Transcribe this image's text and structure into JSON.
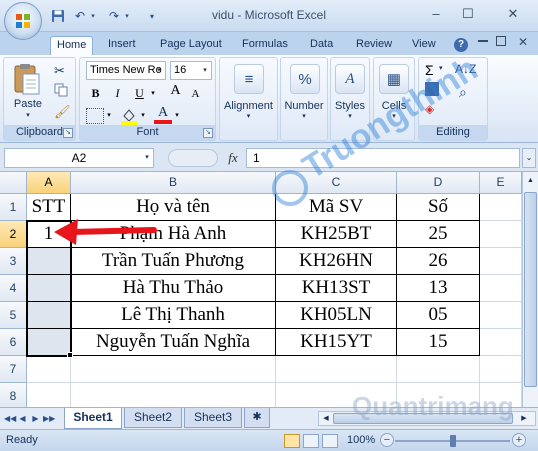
{
  "window": {
    "title": "vidu - Microsoft Excel",
    "minimize": "–",
    "maximize": "☐",
    "close": "✕"
  },
  "quick_access": {
    "save_icon": "save-icon",
    "undo_icon": "undo-icon",
    "redo_icon": "redo-icon"
  },
  "ribbon": {
    "tabs": [
      "Home",
      "Insert",
      "Page Layout",
      "Formulas",
      "Data",
      "Review",
      "View"
    ],
    "active_tab": "Home",
    "clipboard": {
      "label": "Clipboard",
      "paste": "Paste"
    },
    "font": {
      "label": "Font",
      "font_name": "Times New Ro",
      "font_size": "16",
      "bold": "B",
      "italic": "I",
      "underline": "U",
      "grow": "A",
      "shrink": "A"
    },
    "alignment": {
      "label": "Alignment"
    },
    "number": {
      "label": "Number",
      "icon_text": "%"
    },
    "styles": {
      "label": "Styles"
    },
    "cells": {
      "label": "Cells"
    },
    "editing": {
      "label": "Editing",
      "sum": "Σ"
    }
  },
  "formula_bar": {
    "name_box": "A2",
    "fx": "fx",
    "value": "1"
  },
  "grid": {
    "columns": [
      "A",
      "B",
      "C",
      "D",
      "E"
    ],
    "rows": [
      "1",
      "2",
      "3",
      "4",
      "5",
      "6",
      "7",
      "8"
    ],
    "selected_cell": "A2",
    "cells": [
      [
        "STT",
        "Họ và tên",
        "Mã SV",
        "Số"
      ],
      [
        "1",
        "Phạm Hà Anh",
        "KH25BT",
        "25"
      ],
      [
        "",
        "Trần Tuấn Phương",
        "KH26HN",
        "26"
      ],
      [
        "",
        "Hà Thu Thảo",
        "KH13ST",
        "13"
      ],
      [
        "",
        "Lê Thị Thanh",
        "KH05LN",
        "05"
      ],
      [
        "",
        "Nguyễn Tuấn Nghĩa",
        "KH15YT",
        "15"
      ]
    ]
  },
  "sheets": {
    "tabs": [
      "Sheet1",
      "Sheet2",
      "Sheet3"
    ],
    "active": "Sheet1"
  },
  "status": {
    "text": "Ready",
    "zoom": "100%",
    "zoom_minus": "−",
    "zoom_plus": "+"
  },
  "watermark": {
    "text_1": "Truongthinh",
    "text_2": "Quantrimang"
  },
  "colors": {
    "arrow": "#e8161c",
    "selection": "#000000",
    "shaded_cells": "#dfe5ef"
  }
}
